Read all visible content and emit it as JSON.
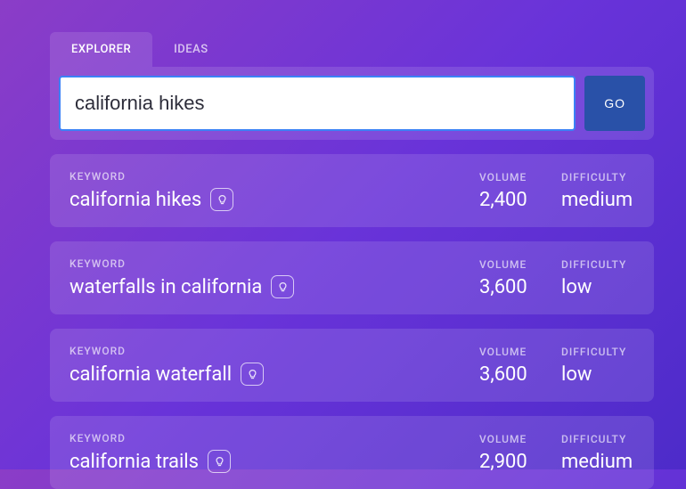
{
  "tabs": {
    "explorer": "EXPLORER",
    "ideas": "IDEAS"
  },
  "search": {
    "value": "california hikes",
    "go_label": "GO"
  },
  "labels": {
    "keyword": "KEYWORD",
    "volume": "VOLUME",
    "difficulty": "DIFFICULTY"
  },
  "results": [
    {
      "keyword": "california hikes",
      "volume": "2,400",
      "difficulty": "medium"
    },
    {
      "keyword": "waterfalls in california",
      "volume": "3,600",
      "difficulty": "low"
    },
    {
      "keyword": "california waterfall",
      "volume": "3,600",
      "difficulty": "low"
    },
    {
      "keyword": "california trails",
      "volume": "2,900",
      "difficulty": "medium"
    }
  ]
}
